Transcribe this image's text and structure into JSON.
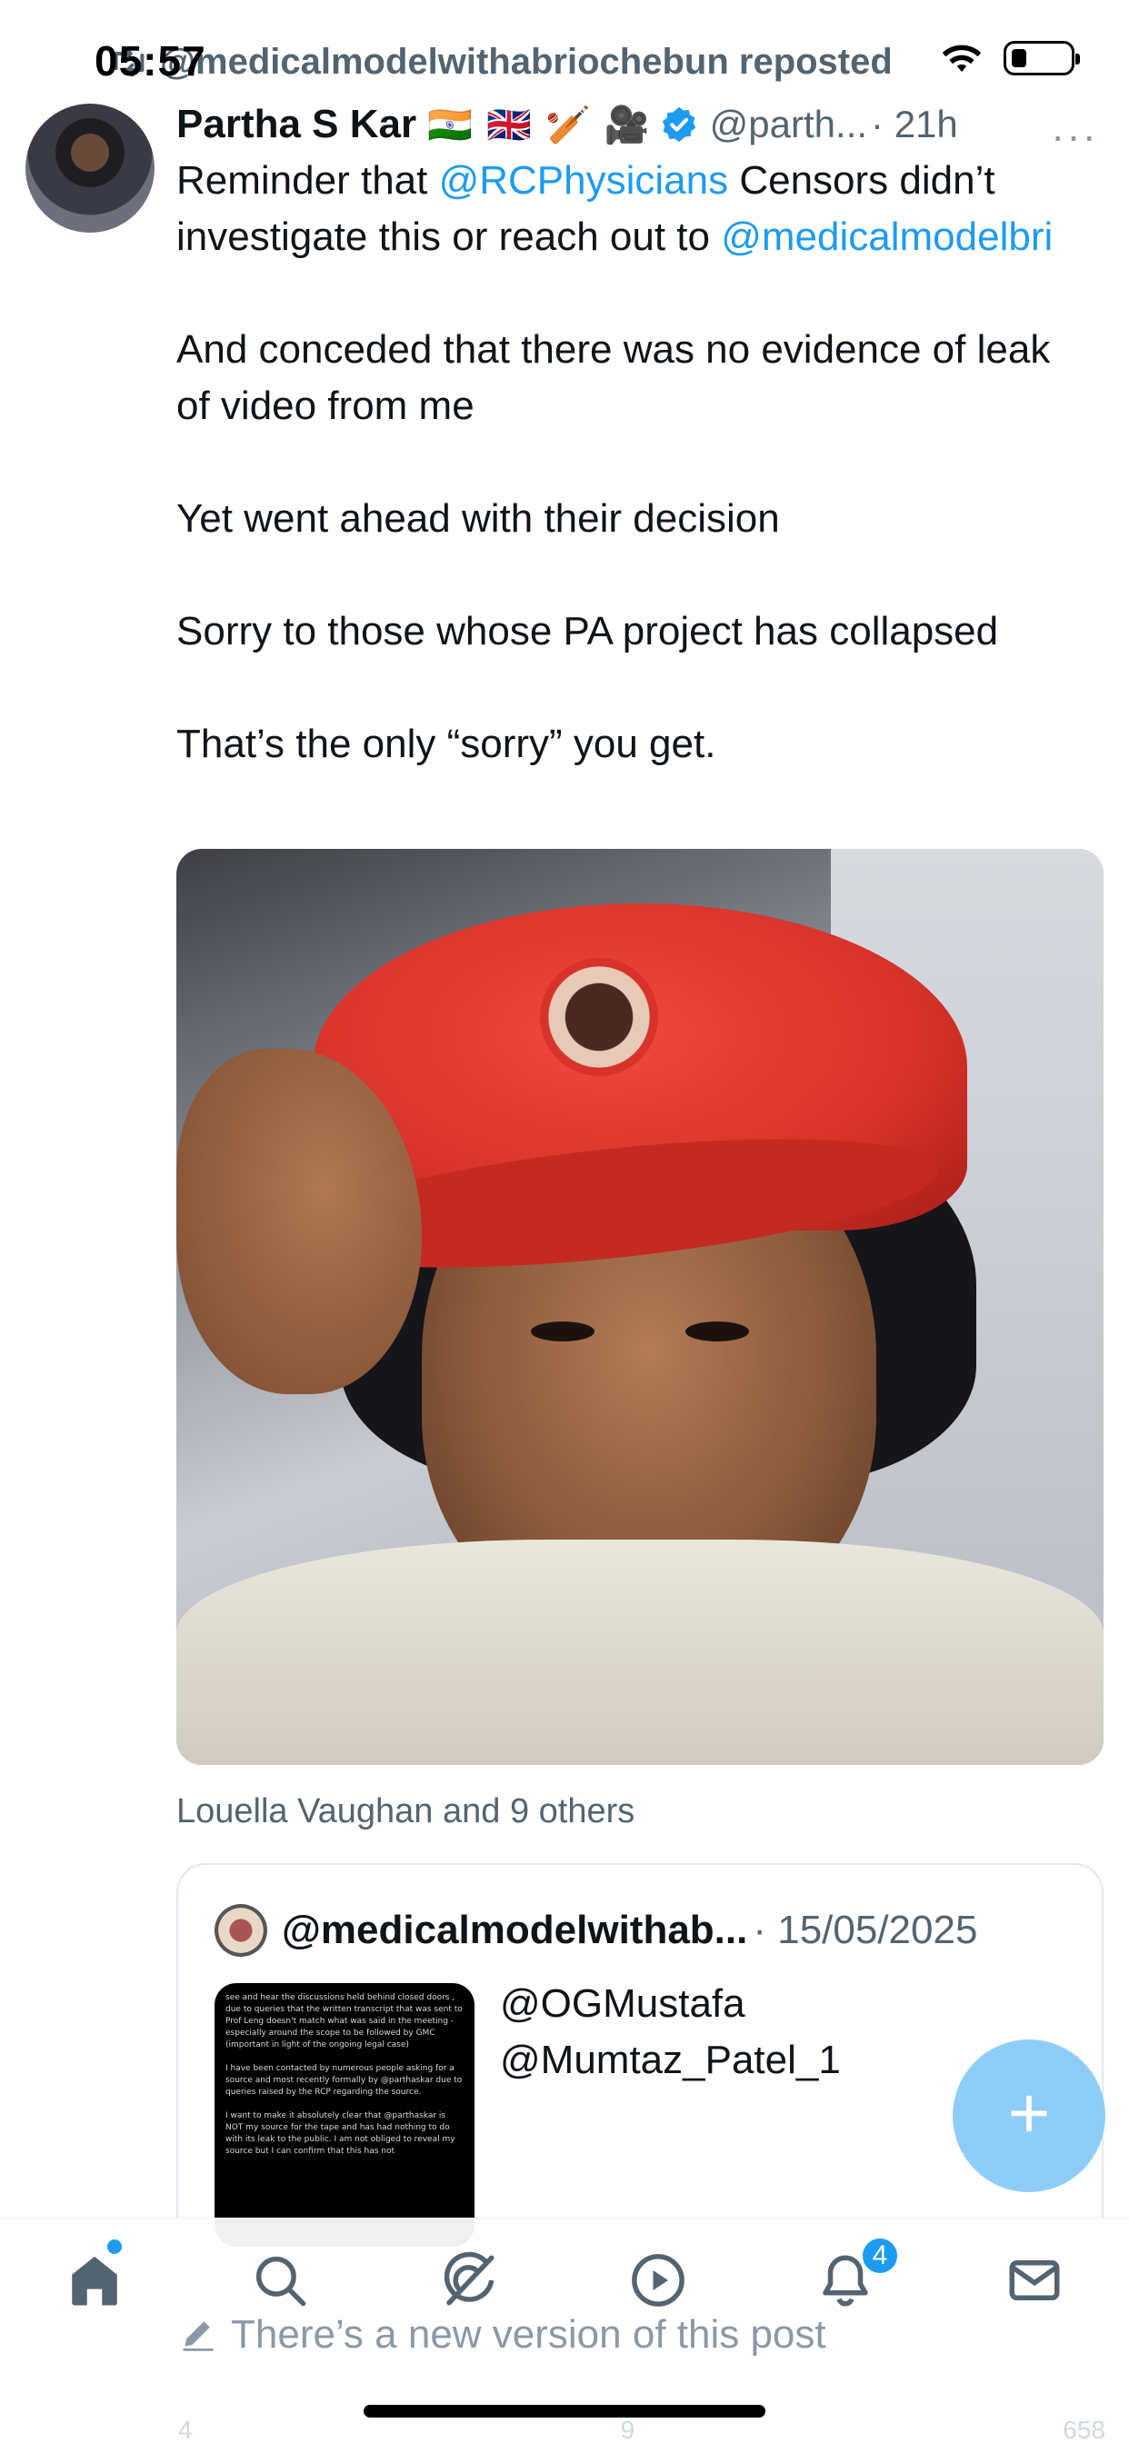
{
  "status_bar": {
    "time": "05:57",
    "repost_text": "@medicalmodelwithabriochebun reposted"
  },
  "post": {
    "author_name": "Partha S Kar",
    "author_emojis": "🇮🇳 🇬🇧 🏏 🎥",
    "handle": "@parth...",
    "time_ago": "· 21h",
    "more": "···",
    "text": {
      "p1_a": "Reminder that ",
      "p1_mention1": "@RCPhysicians",
      "p1_b": " Censors didn’t investigate this or reach out to ",
      "p1_mention2": "@medicalmodelbri",
      "p2": "And conceded that there was no evidence of leak of video from me",
      "p3": "Yet went ahead with their decision",
      "p4": "Sorry to those whose PA project has collapsed",
      "p5": "That’s the only “sorry” you get."
    },
    "liked_by": "Louella Vaughan and 9 others"
  },
  "quote": {
    "handle": "@medicalmodelwithab...",
    "date": "· 15/05/2025",
    "text_line1": "@OGMustafa",
    "text_line2": "@Mumtaz_Patel_1",
    "thumb_text": [
      "see and hear the discussions held behind closed doors , due to queries that the written transcript that was sent to Prof Leng doesn't match what was said in the meeting - especially around the scope to be followed by GMC (important in light of the ongoing legal case)",
      "I have been contacted by numerous people asking for a source and most recently formally by @parthaskar due to queries raised by the RCP regarding the source.",
      "I want to make it absolutely clear that @parthaskar is NOT my source for the tape and has had nothing to do with its leak to the public. I am not obliged to reveal my source but I can confirm that this has not"
    ]
  },
  "fab": {
    "label": "+"
  },
  "nav": {
    "notification_count": "4",
    "new_version_text": "There’s a new version of this post"
  },
  "faded_actions": [
    "4",
    "9",
    "658"
  ]
}
